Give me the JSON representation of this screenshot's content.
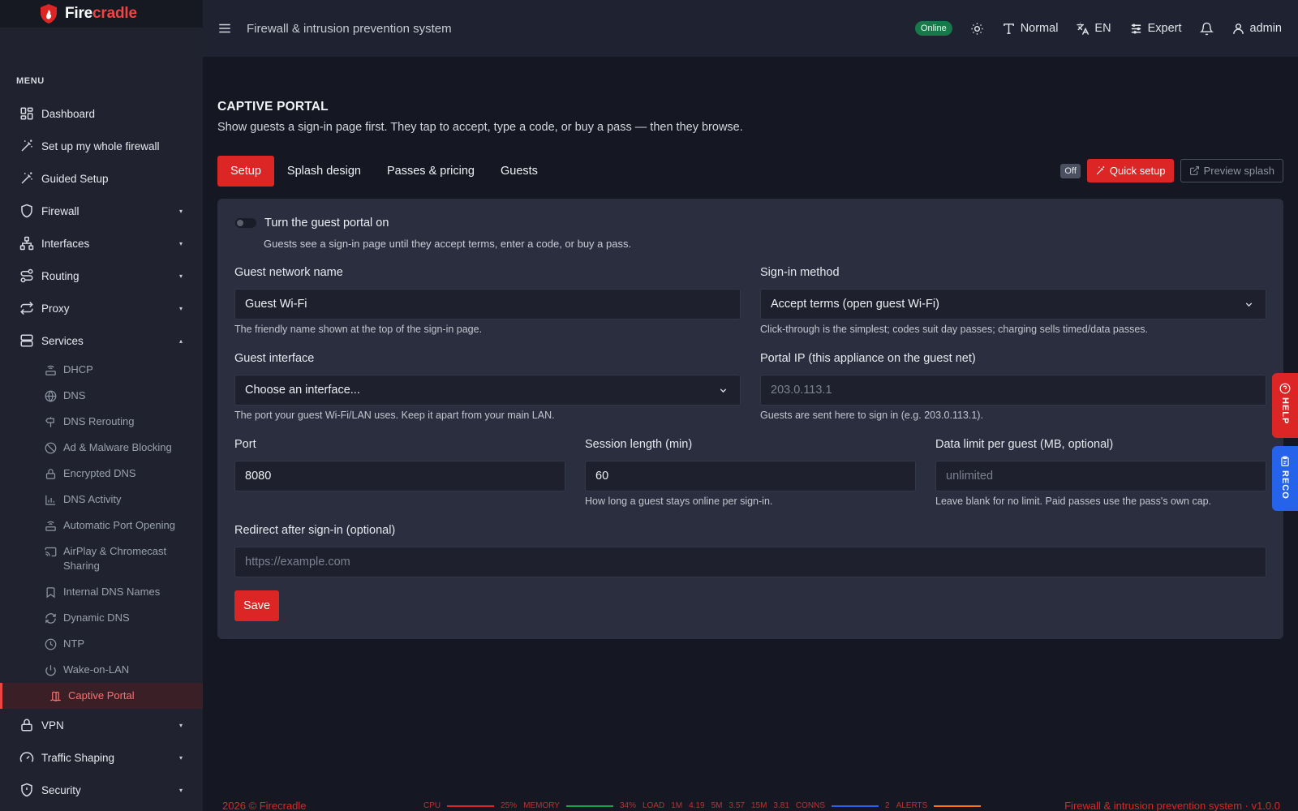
{
  "brand": {
    "name_part1": "Fire",
    "name_part2": "cradle"
  },
  "sidebar": {
    "menu_heading": "MENU",
    "items": [
      {
        "label": "Dashboard"
      },
      {
        "label": "Set up my whole firewall"
      },
      {
        "label": "Guided Setup"
      },
      {
        "label": "Firewall",
        "expandable": true
      },
      {
        "label": "Interfaces",
        "expandable": true
      },
      {
        "label": "Routing",
        "expandable": true
      },
      {
        "label": "Proxy",
        "expandable": true
      },
      {
        "label": "Services",
        "expandable": true,
        "expanded": true
      }
    ],
    "services_children": [
      {
        "label": "DHCP"
      },
      {
        "label": "DNS"
      },
      {
        "label": "DNS Rerouting"
      },
      {
        "label": "Ad & Malware Blocking"
      },
      {
        "label": "Encrypted DNS"
      },
      {
        "label": "DNS Activity"
      },
      {
        "label": "Automatic Port Opening"
      },
      {
        "label": "AirPlay & Chromecast Sharing"
      },
      {
        "label": "Internal DNS Names"
      },
      {
        "label": "Dynamic DNS"
      },
      {
        "label": "NTP"
      },
      {
        "label": "Wake-on-LAN"
      },
      {
        "label": "Captive Portal",
        "active": true
      }
    ],
    "after_items": [
      {
        "label": "VPN",
        "expandable": true
      },
      {
        "label": "Traffic Shaping",
        "expandable": true
      },
      {
        "label": "Security",
        "expandable": true
      }
    ],
    "caret_down": "▾",
    "caret_up": "▴"
  },
  "topbar": {
    "title": "Firewall & intrusion prevention system",
    "status": "Online",
    "text_size": "Normal",
    "language": "EN",
    "mode": "Expert",
    "user": "admin"
  },
  "page": {
    "heading": "CAPTIVE PORTAL",
    "subtitle": "Show guests a sign-in page first. They tap to accept, type a code, or buy a pass — then they browse.",
    "tabs": [
      {
        "label": "Setup",
        "active": true
      },
      {
        "label": "Splash design"
      },
      {
        "label": "Passes & pricing"
      },
      {
        "label": "Guests"
      }
    ],
    "state_badge": "Off",
    "quick_setup": "Quick setup",
    "preview_splash": "Preview splash"
  },
  "form": {
    "toggle_label": "Turn the guest portal on",
    "toggle_help": "Guests see a sign-in page until they accept terms, enter a code, or buy a pass.",
    "toggle_on": false,
    "network_name": {
      "label": "Guest network name",
      "value": "Guest Wi-Fi",
      "help": "The friendly name shown at the top of the sign-in page."
    },
    "signin_method": {
      "label": "Sign-in method",
      "value": "Accept terms (open guest Wi-Fi)",
      "help": "Click-through is the simplest; codes suit day passes; charging sells timed/data passes."
    },
    "guest_interface": {
      "label": "Guest interface",
      "value": "Choose an interface...",
      "help": "The port your guest Wi-Fi/LAN uses. Keep it apart from your main LAN."
    },
    "portal_ip": {
      "label": "Portal IP (this appliance on the guest net)",
      "placeholder": "203.0.113.1",
      "help": "Guests are sent here to sign in (e.g. 203.0.113.1)."
    },
    "port": {
      "label": "Port",
      "value": "8080"
    },
    "session_length": {
      "label": "Session length (min)",
      "value": "60",
      "help": "How long a guest stays online per sign-in."
    },
    "data_limit": {
      "label": "Data limit per guest (MB, optional)",
      "placeholder": "unlimited",
      "help": "Leave blank for no limit. Paid passes use the pass's own cap."
    },
    "redirect": {
      "label": "Redirect after sign-in (optional)",
      "placeholder": "https://example.com"
    },
    "save_label": "Save"
  },
  "floating": {
    "help": "HELP",
    "reco": "RECO"
  },
  "footer": {
    "copyright": "2026 © Firecradle",
    "cpu_label": "CPU",
    "cpu_value": "25%",
    "memory_label": "MEMORY",
    "memory_value": "34%",
    "load_label": "LOAD",
    "load_1m_label": "1M",
    "load_1m": "4.19",
    "load_5m_label": "5M",
    "load_5m": "3.57",
    "load_15m_label": "15M",
    "load_15m": "3.81",
    "conns_label": "CONNS",
    "conns_value": "2",
    "alerts_label": "ALERTS",
    "version": "Firewall & intrusion prevention system · v1.0.0"
  },
  "colors": {
    "accent": "#dc2626",
    "online": "#16794a",
    "reco": "#2563eb",
    "background": "#151822",
    "card": "#2a2e3e"
  }
}
